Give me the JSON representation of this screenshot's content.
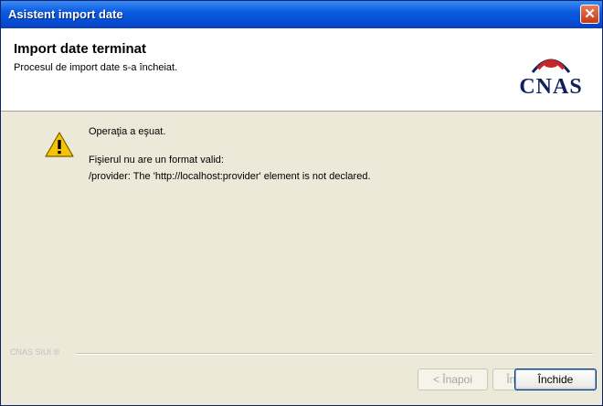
{
  "window": {
    "title": "Asistent import date",
    "close_symbol": "✕"
  },
  "header": {
    "title": "Import date terminat",
    "subtitle": "Procesul de import date s-a încheiat.",
    "logo_text": "CNAS",
    "logo_colors": {
      "arc": "#C62828",
      "swoosh": "#10205A"
    }
  },
  "message": {
    "icon": "warning-icon",
    "status": "Operaţia a eşuat.",
    "line1": "Fişierul nu are un format valid:",
    "line2": "/provider: The 'http://localhost:provider' element is not declared."
  },
  "footer": {
    "brand": "CNAS SIUI ®",
    "buttons": {
      "back": "< Înapoi",
      "next": "Înainte >",
      "close": "Închide"
    }
  }
}
